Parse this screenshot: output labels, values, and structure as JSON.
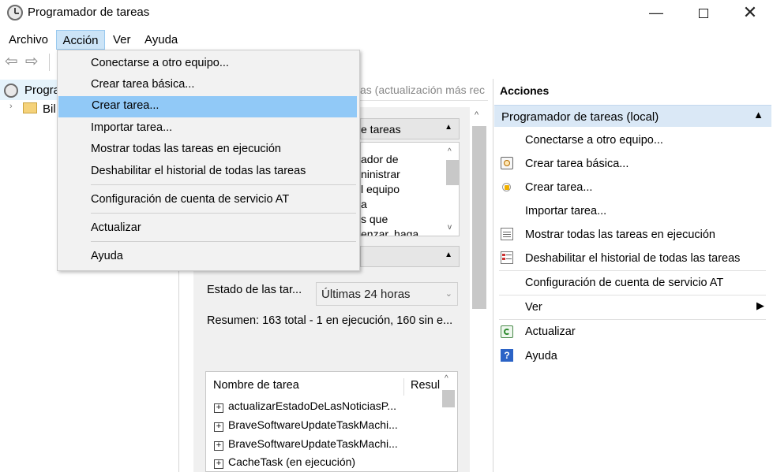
{
  "window": {
    "title": "Programador de tareas",
    "minimize": "—",
    "close": "✕"
  },
  "menubar": {
    "items": [
      "Archivo",
      "Acción",
      "Ver",
      "Ayuda"
    ]
  },
  "tree": {
    "root_label": "Progra",
    "child_label": "Bil"
  },
  "center": {
    "header_text": "as (actualización más rec",
    "section1_title": "e tareas",
    "section1_lines": [
      "ador de",
      "ninistrar",
      "l equipo",
      "a",
      "s que",
      "enzar, haga"
    ],
    "status_label": "Estado de las tar...",
    "status_value": "Últimas 24 horas",
    "summary": "Resumen: 163 total - 1 en ejecución, 160 sin e...",
    "table_headers": [
      "Nombre de tarea",
      "Resul"
    ],
    "tasks": [
      "actualizarEstadoDeLasNoticiasP...",
      "BraveSoftwareUpdateTaskMachi...",
      "BraveSoftwareUpdateTaskMachi...",
      "CacheTask (en ejecución)"
    ]
  },
  "actions": {
    "title": "Acciones",
    "group": "Programador de tareas (local)",
    "items": [
      {
        "label": "Conectarse a otro equipo...",
        "icon": "none"
      },
      {
        "label": "Crear tarea básica...",
        "icon": "scheduled-task-icon"
      },
      {
        "label": "Crear tarea...",
        "icon": "new-task-icon"
      },
      {
        "label": "Importar tarea...",
        "icon": "none"
      },
      {
        "label": "Mostrar todas las tareas en ejecución",
        "icon": "running-tasks-icon"
      },
      {
        "label": "Deshabilitar el historial de todas las tareas",
        "icon": "history-icon"
      },
      {
        "label": "Configuración de cuenta de servicio AT",
        "icon": "none"
      },
      {
        "label": "Ver",
        "icon": "none"
      },
      {
        "label": "Actualizar",
        "icon": "refresh-icon"
      },
      {
        "label": "Ayuda",
        "icon": "help-icon"
      }
    ]
  },
  "accion_menu": {
    "items": [
      "Conectarse a otro equipo...",
      "Crear tarea básica...",
      "Crear tarea...",
      "Importar tarea...",
      "Mostrar todas las tareas en ejecución",
      "Deshabilitar el historial de todas las tareas",
      "Configuración de cuenta de servicio AT",
      "Actualizar",
      "Ayuda"
    ],
    "highlighted": "Crear tarea..."
  },
  "colors": {
    "menu_highlight": "#91c9f7",
    "menubar_active": "#cce4f7",
    "actions_group_bg": "#dae8f6"
  }
}
